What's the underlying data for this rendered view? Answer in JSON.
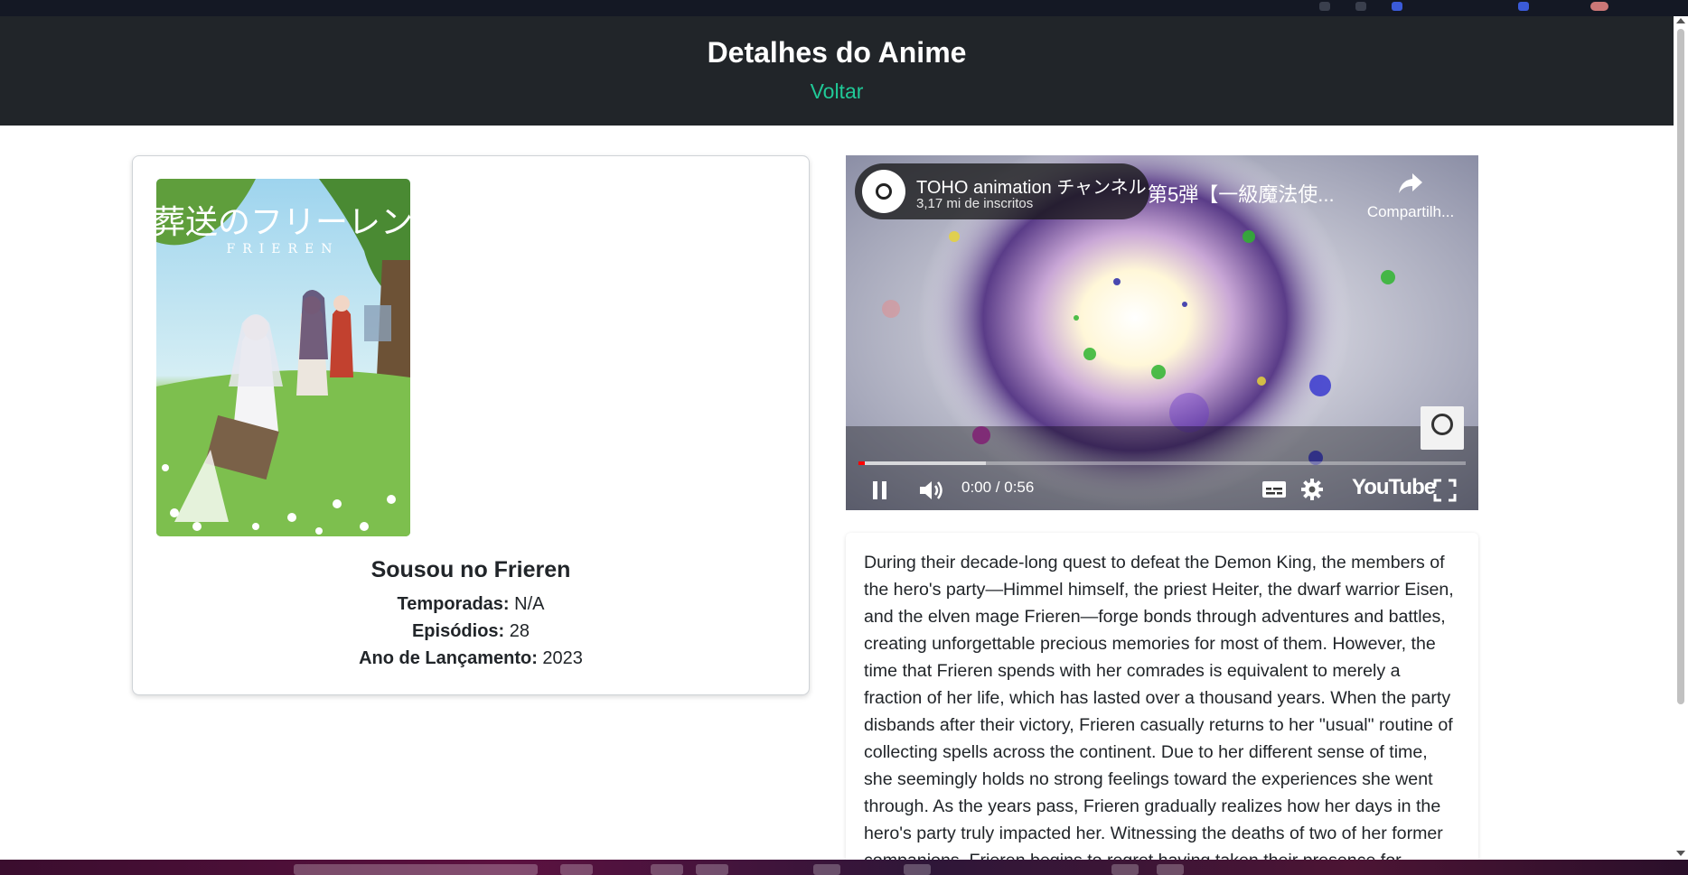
{
  "header": {
    "title": "Detalhes do Anime",
    "back_link": "Voltar"
  },
  "anime": {
    "name": "Sousou no Frieren",
    "poster_title_jp": "葬送のフリーレン",
    "poster_title_en": "FRIEREN",
    "info": [
      {
        "label": "Temporadas:",
        "value": "N/A"
      },
      {
        "label": "Episódios:",
        "value": "28"
      },
      {
        "label": "Ano de Lançamento:",
        "value": "2023"
      }
    ]
  },
  "video": {
    "channel_name": "TOHO animation チャンネル",
    "channel_subs": "3,17 mi de inscritos",
    "title": "第5弾【一級魔法使...",
    "share_label": "Compartilh...",
    "time": "0:00 / 0:56",
    "played_fraction": 0.01,
    "loaded_fraction": 0.21,
    "logo_text": "YouTube",
    "player_state": "playing",
    "icons": [
      "pause-icon",
      "volume-icon",
      "subtitles-icon",
      "settings-icon",
      "fullscreen-icon",
      "share-icon"
    ]
  },
  "description": "During their decade-long quest to defeat the Demon King, the members of the hero's party—Himmel himself, the priest Heiter, the dwarf warrior Eisen, and the elven mage Frieren—forge bonds through adventures and battles, creating unforgettable precious memories for most of them. However, the time that Frieren spends with her comrades is equivalent to merely a fraction of her life, which has lasted over a thousand years. When the party disbands after their victory, Frieren casually returns to her \"usual\" routine of collecting spells across the continent. Due to her different sense of time, she seemingly holds no strong feelings toward the experiences she went through. As the years pass, Frieren gradually realizes how her days in the hero's party truly impacted her. Witnessing the deaths of two of her former companions, Frieren begins to regret having taken their presence for granted.",
  "colors": {
    "header_bg": "#212529",
    "link": "#20c997",
    "progress_played": "#ff0000"
  }
}
